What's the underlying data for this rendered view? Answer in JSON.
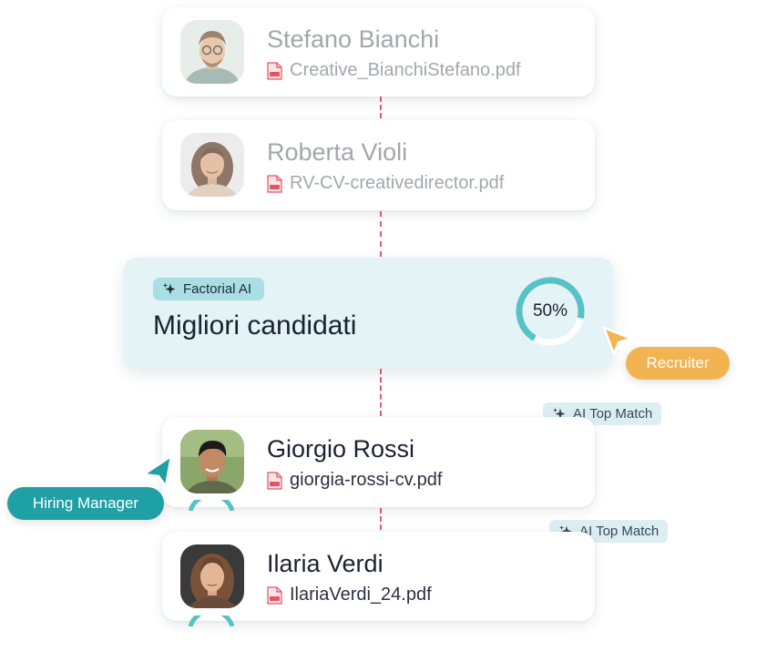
{
  "candidates": [
    {
      "name": "Stefano Bianchi",
      "file": "Creative_BianchiStefano.pdf",
      "faded": true
    },
    {
      "name": "Roberta Violi",
      "file": "RV-CV-creativedirector.pdf",
      "faded": true
    },
    {
      "name": "Giorgio Rossi",
      "file": "giorgia-rossi-cv.pdf",
      "faded": false
    },
    {
      "name": "Ilaria Verdi",
      "file": "IlariaVerdi_24.pdf",
      "faded": false
    }
  ],
  "ai_panel": {
    "badge": "Factorial AI",
    "title": "Migliori candidati",
    "progress_label": "50%",
    "progress_fraction": 0.7
  },
  "match_badges": [
    "AI Top Match",
    "AI Top Match"
  ],
  "roles": {
    "recruiter": "Recruiter",
    "hiring_manager": "Hiring Manager"
  },
  "icons": [
    "pdf-file-icon",
    "sparkle-icon",
    "cursor-pointer-icon"
  ],
  "colors": {
    "accent_teal": "#1fa0a4",
    "recruiter_yellow": "#f2b451",
    "connector_red": "#ea5a70",
    "ai_panel_bg": "#e3f3f6",
    "pdf_red": "#e05566"
  }
}
